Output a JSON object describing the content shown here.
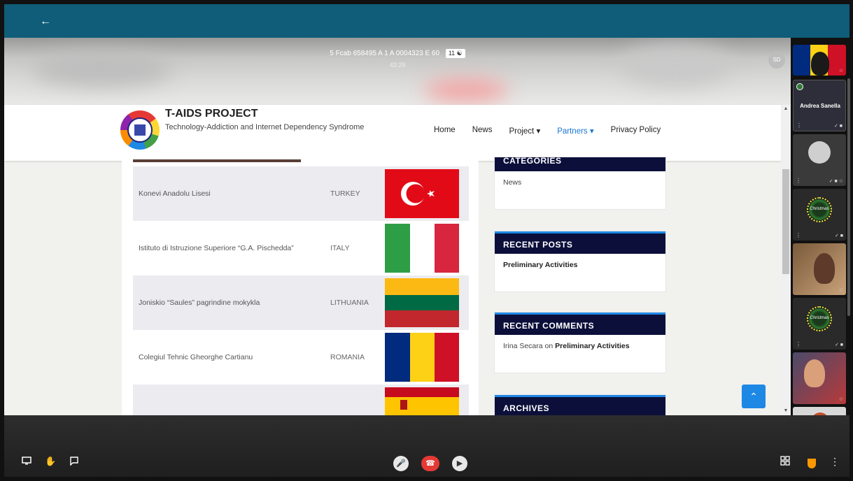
{
  "top": {
    "back_icon": "arrow-left-icon"
  },
  "meeting": {
    "code": "5 Fcab 658495 A 1 A 0004323 E 60",
    "participants": "11",
    "timer": "43:29",
    "self_initials": "SD"
  },
  "site": {
    "title": "T-AIDS PROJECT",
    "tagline": "Technology-Addiction and Internet Dependency Syndrome",
    "nav": {
      "home": "Home",
      "news": "News",
      "project": "Project ▾",
      "partners": "Partners ▾",
      "privacy": "Privacy Policy"
    }
  },
  "partners": [
    {
      "name": "Konevi Anadolu Lisesi",
      "country": "TURKEY"
    },
    {
      "name": "Istituto di Istruzione Superiore “G.A. Pischedda”",
      "country": "ITALY"
    },
    {
      "name": "Joniskio “Saules” pagrindine mokykla",
      "country": "LITHUANIA"
    },
    {
      "name": "Colegiul Tehnic Gheorghe Cartianu",
      "country": "ROMANIA"
    },
    {
      "name": "",
      "country": ""
    }
  ],
  "sidebar": {
    "categories_title": "CATEGORIES",
    "categories_item": "News",
    "recent_posts_title": "RECENT POSTS",
    "recent_posts_item": "Preliminary Activities",
    "recent_comments_title": "RECENT COMMENTS",
    "comment_author": "Irina Secara",
    "comment_on": "on",
    "comment_post": "Preliminary Activities",
    "archives_title": "ARCHIVES"
  },
  "tiles": {
    "named_participant": "Andrea Sanella",
    "christmas_label": "Christmas"
  },
  "colors": {
    "topbar": "#0f5d78",
    "widget_head": "#0b0f3a",
    "accent": "#1e88e5",
    "hangup": "#e53935"
  },
  "bottom": {
    "icons": [
      "present-screen-icon",
      "raise-hand-icon",
      "chat-icon",
      "microphone-icon",
      "hang-up-icon",
      "camera-icon",
      "grid-layout-icon",
      "shield-icon",
      "more-options-icon"
    ]
  }
}
